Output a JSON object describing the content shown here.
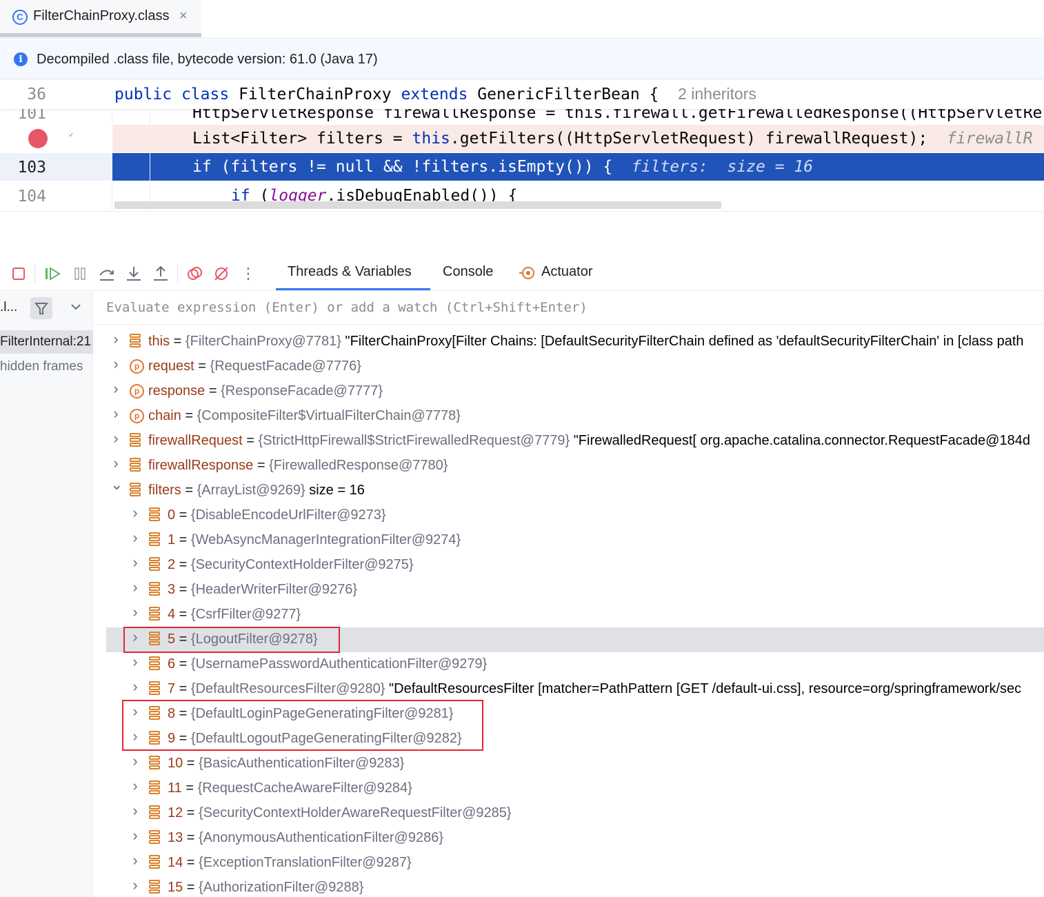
{
  "tab": {
    "icon": "class-icon",
    "icon_glyph": "C",
    "label": "FilterChainProxy.class",
    "close": "×"
  },
  "banner": {
    "icon": "info-icon",
    "text": "Decompiled .class file, bytecode version: 61.0 (Java 17)"
  },
  "editor": {
    "sticky": {
      "line": "36",
      "kw1": "public",
      "kw2": "class",
      "name": "FilterChainProxy",
      "kw3": "extends",
      "base": "GenericFilterBean {",
      "hint": "2 inheritors"
    },
    "line101": {
      "number": "101",
      "code": "HttpServletResponse firewallResponse = this.firewall.getFirewalledResponse((HttpServletRe"
    },
    "line102": {
      "code_a": "List<Filter> filters = ",
      "code_this": "this",
      "code_b": ".getFilters((HttpServletRequest) firewallRequest);",
      "inline": "firewallR"
    },
    "line103": {
      "number": "103",
      "kw": "if",
      "code": " (filters != null && !filters.isEmpty()) {",
      "inline": "filters:  size = 16"
    },
    "line104": {
      "number": "104",
      "kw": "if",
      "code_a": " (",
      "logger": "logger",
      "code_b": ".isDebugEnabled()) {"
    }
  },
  "toolbar": {
    "buttons": [
      "stop-icon",
      "resume-icon",
      "pause-icon",
      "step-over-icon",
      "step-into-icon",
      "step-out-icon",
      "view-breakpoints-icon",
      "mute-breakpoints-icon",
      "more-icon"
    ],
    "tabs": [
      "Threads & Variables",
      "Console",
      "Actuator"
    ]
  },
  "frames": {
    "head_label": ".l...",
    "items": [
      "FilterInternal:21",
      "hidden frames"
    ]
  },
  "evaluate": {
    "placeholder": "Evaluate expression (Enter) or add a watch (Ctrl+Shift+Enter)"
  },
  "variables": [
    {
      "kind": "field",
      "name": "this",
      "type": "{FilterChainProxy@7781}",
      "value": "\"FilterChainProxy[Filter Chains: [DefaultSecurityFilterChain defined as 'defaultSecurityFilterChain' in [class path"
    },
    {
      "kind": "param",
      "name": "request",
      "type": "{RequestFacade@7776}",
      "value": ""
    },
    {
      "kind": "param",
      "name": "response",
      "type": "{ResponseFacade@7777}",
      "value": ""
    },
    {
      "kind": "param",
      "name": "chain",
      "type": "{CompositeFilter$VirtualFilterChain@7778}",
      "value": ""
    },
    {
      "kind": "field",
      "name": "firewallRequest",
      "type": "{StrictHttpFirewall$StrictFirewalledRequest@7779}",
      "value": "\"FirewalledRequest[ org.apache.catalina.connector.RequestFacade@184d"
    },
    {
      "kind": "field",
      "name": "firewallResponse",
      "type": "{FirewalledResponse@7780}",
      "value": ""
    },
    {
      "kind": "field",
      "name": "filters",
      "type": "{ArrayList@9269}",
      "value": " size = 16",
      "expanded": true
    }
  ],
  "filters_children": [
    {
      "index": "0",
      "type": "{DisableEncodeUrlFilter@9273}",
      "value": ""
    },
    {
      "index": "1",
      "type": "{WebAsyncManagerIntegrationFilter@9274}",
      "value": ""
    },
    {
      "index": "2",
      "type": "{SecurityContextHolderFilter@9275}",
      "value": ""
    },
    {
      "index": "3",
      "type": "{HeaderWriterFilter@9276}",
      "value": ""
    },
    {
      "index": "4",
      "type": "{CsrfFilter@9277}",
      "value": ""
    },
    {
      "index": "5",
      "type": "{LogoutFilter@9278}",
      "value": ""
    },
    {
      "index": "6",
      "type": "{UsernamePasswordAuthenticationFilter@9279}",
      "value": ""
    },
    {
      "index": "7",
      "type": "{DefaultResourcesFilter@9280}",
      "value": "\"DefaultResourcesFilter [matcher=PathPattern [GET /default-ui.css], resource=org/springframework/sec"
    },
    {
      "index": "8",
      "type": "{DefaultLoginPageGeneratingFilter@9281}",
      "value": ""
    },
    {
      "index": "9",
      "type": "{DefaultLogoutPageGeneratingFilter@9282}",
      "value": ""
    },
    {
      "index": "10",
      "type": "{BasicAuthenticationFilter@9283}",
      "value": ""
    },
    {
      "index": "11",
      "type": "{RequestCacheAwareFilter@9284}",
      "value": ""
    },
    {
      "index": "12",
      "type": "{SecurityContextHolderAwareRequestFilter@9285}",
      "value": ""
    },
    {
      "index": "13",
      "type": "{AnonymousAuthenticationFilter@9286}",
      "value": ""
    },
    {
      "index": "14",
      "type": "{ExceptionTranslationFilter@9287}",
      "value": ""
    },
    {
      "index": "15",
      "type": "{AuthorizationFilter@9288}",
      "value": ""
    }
  ],
  "colors": {
    "accent": "#3574f0",
    "highlight_box": "#e0262f",
    "current_line": "#2154b8",
    "breakpoint": "#e55765"
  }
}
